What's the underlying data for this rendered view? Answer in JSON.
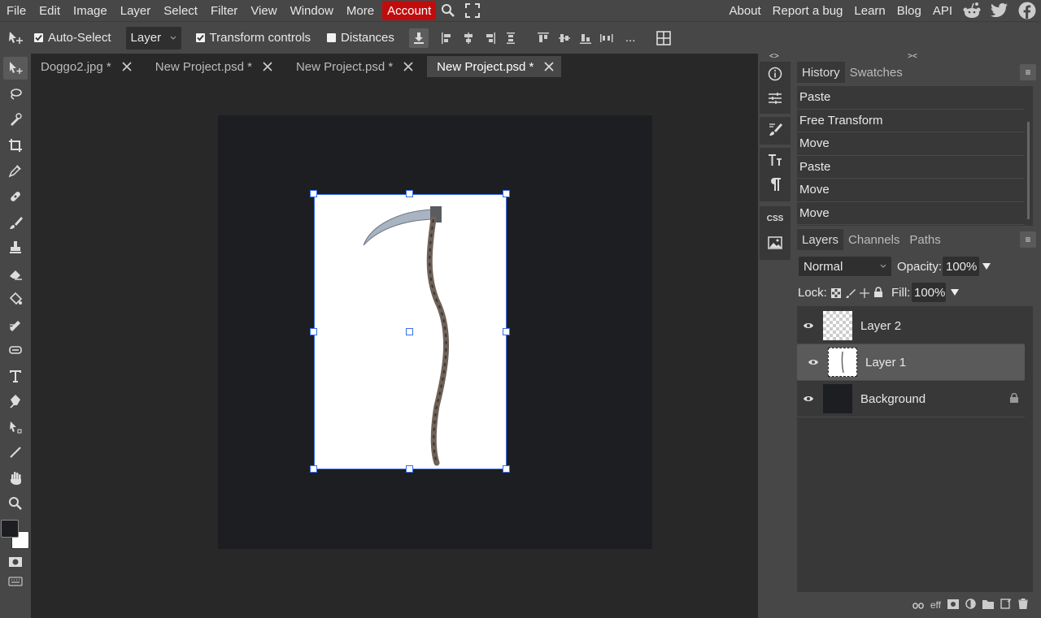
{
  "menubar": {
    "items": [
      "File",
      "Edit",
      "Image",
      "Layer",
      "Select",
      "Filter",
      "View",
      "Window",
      "More"
    ],
    "account": "Account",
    "right_links": [
      "About",
      "Report a bug",
      "Learn",
      "Blog",
      "API"
    ]
  },
  "options": {
    "auto_select_label": "Auto-Select",
    "auto_select_checked": true,
    "layer_select_value": "Layer",
    "transform_controls_label": "Transform controls",
    "transform_controls_checked": true,
    "distances_label": "Distances",
    "distances_checked": false,
    "more_label": "..."
  },
  "tabs": [
    {
      "label": "Doggo2.jpg *",
      "active": false
    },
    {
      "label": "New Project.psd *",
      "active": false
    },
    {
      "label": "New Project.psd *",
      "active": false
    },
    {
      "label": "New Project.psd *",
      "active": true
    }
  ],
  "rail": {
    "collapse_left": "<>",
    "collapse_right": "><",
    "css_label": "CSS"
  },
  "history_panel": {
    "tabs": [
      "History",
      "Swatches"
    ],
    "items": [
      "Paste",
      "Free Transform",
      "Move",
      "Paste",
      "Move",
      "Move"
    ]
  },
  "layers_panel": {
    "tabs": [
      "Layers",
      "Channels",
      "Paths"
    ],
    "blend_mode": "Normal",
    "opacity_label": "Opacity:",
    "opacity_value": "100%",
    "lock_label": "Lock:",
    "fill_label": "Fill:",
    "fill_value": "100%",
    "layers": [
      {
        "name": "Layer 2",
        "selected": false
      },
      {
        "name": "Layer 1",
        "selected": true
      },
      {
        "name": "Background",
        "selected": false,
        "locked": true
      }
    ],
    "footer_eff": "eff"
  },
  "colors": {
    "accent": "#c10c0c",
    "selection": "#3a6ee8",
    "panel": "#474747",
    "canvas": "#1d1e22"
  }
}
